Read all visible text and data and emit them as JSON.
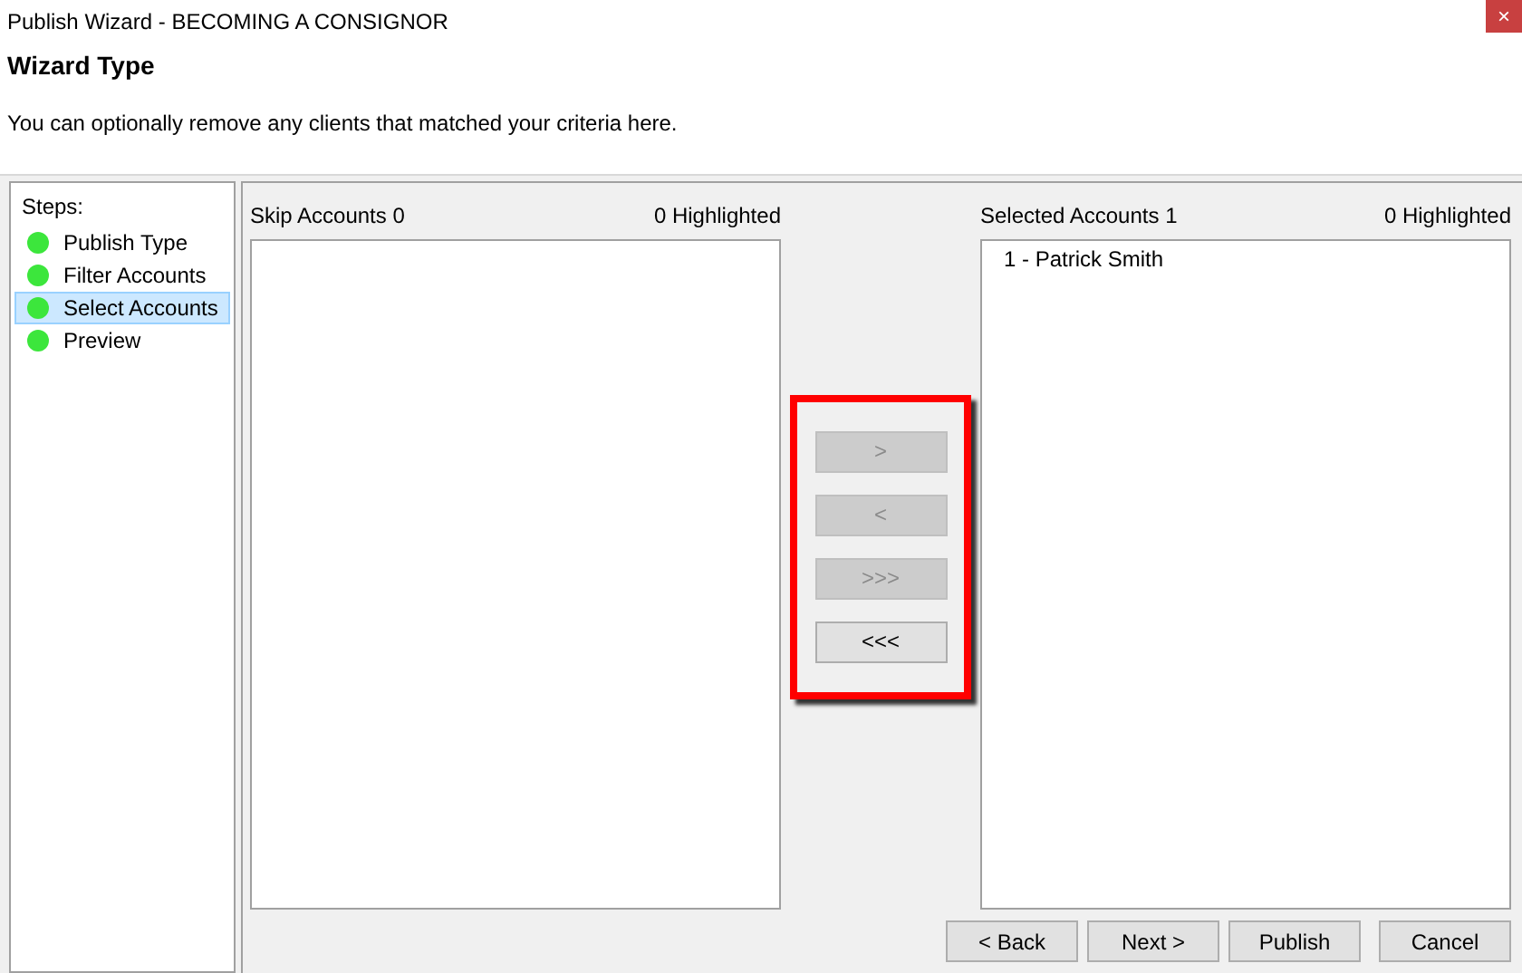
{
  "window": {
    "title": "Publish Wizard - BECOMING A CONSIGNOR",
    "close": "×"
  },
  "header": {
    "title": "Wizard Type",
    "description": "You can optionally remove any clients that matched your criteria here."
  },
  "steps": {
    "label": "Steps:",
    "items": [
      {
        "label": "Publish Type",
        "selected": false,
        "color": "#3ce63c"
      },
      {
        "label": "Filter Accounts",
        "selected": false,
        "color": "#3ce63c"
      },
      {
        "label": "Select Accounts",
        "selected": true,
        "color": "#3ce63c"
      },
      {
        "label": "Preview",
        "selected": false,
        "color": "#3ce63c"
      }
    ]
  },
  "skip_list": {
    "title": "Skip Accounts 0",
    "highlighted": "0 Highlighted"
  },
  "move_buttons": [
    {
      "label": ">",
      "disabled": true
    },
    {
      "label": "<",
      "disabled": true
    },
    {
      "label": ">>>",
      "disabled": true
    },
    {
      "label": "<<<",
      "disabled": false
    }
  ],
  "selected_list": {
    "title": "Selected Accounts 1",
    "highlighted": "0 Highlighted",
    "items": [
      "1 - Patrick Smith"
    ]
  },
  "buttons": [
    "< Back",
    "Next >",
    "Publish",
    "Cancel"
  ]
}
